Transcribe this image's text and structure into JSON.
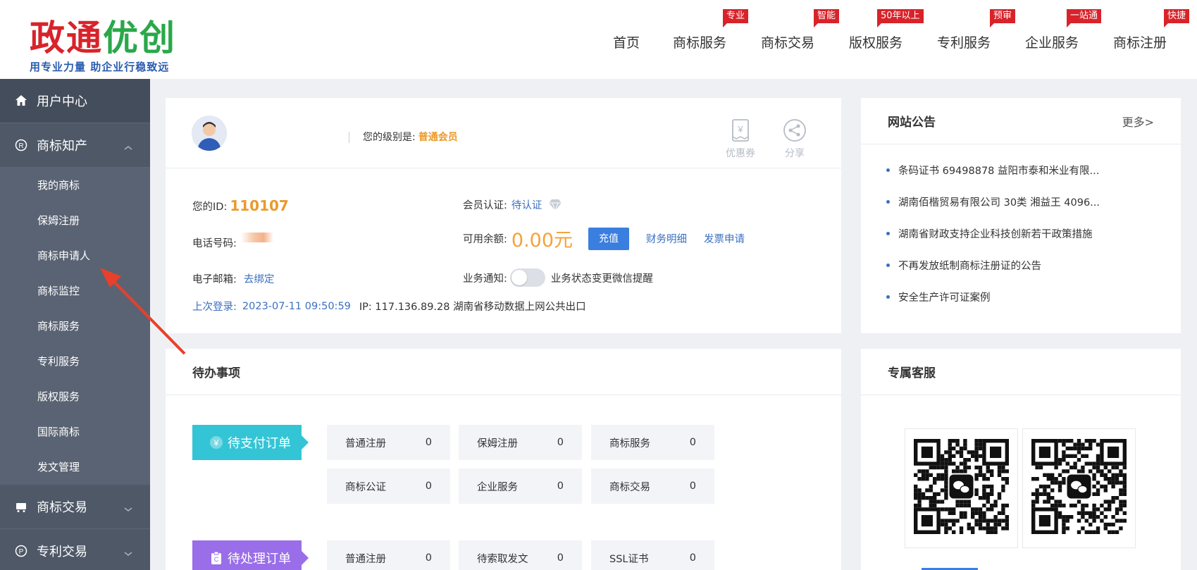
{
  "brand": {
    "name_part1": "政通",
    "name_part2": "优创",
    "slogan": "用专业力量 助企业行稳致远"
  },
  "nav": [
    {
      "label": "首页",
      "badge": ""
    },
    {
      "label": "商标服务",
      "badge": "专业"
    },
    {
      "label": "商标交易",
      "badge": "智能"
    },
    {
      "label": "版权服务",
      "badge": "50年以上"
    },
    {
      "label": "专利服务",
      "badge": "预审"
    },
    {
      "label": "企业服务",
      "badge": "一站通"
    },
    {
      "label": "商标注册",
      "badge": "快捷"
    }
  ],
  "sidebar": {
    "home": "用户中心",
    "groups": [
      {
        "label": "商标知产",
        "expanded": true,
        "icon": "registered-icon"
      },
      {
        "label": "商标交易",
        "expanded": false,
        "icon": "cart-icon"
      },
      {
        "label": "专利交易",
        "expanded": false,
        "icon": "patent-icon"
      }
    ],
    "sub_items": [
      "我的商标",
      "保姆注册",
      "商标申请人",
      "商标监控",
      "商标服务",
      "专利服务",
      "版权服务",
      "国际商标",
      "发文管理"
    ]
  },
  "profile": {
    "level_label": "您的级别是:",
    "level_value": "普通会员",
    "coupon_label": "优惠券",
    "share_label": "分享",
    "id_label": "您的ID:",
    "id_value": "110107",
    "verify_label": "会员认证:",
    "verify_value": "待认证",
    "phone_label": "电话号码:",
    "balance_label": "可用余额:",
    "balance_value": "0.00元",
    "recharge": "充值",
    "finance_detail": "财务明细",
    "invoice": "发票申请",
    "email_label": "电子邮箱:",
    "email_bind": "去绑定",
    "notify_label": "业务通知:",
    "notify_text": "业务状态变更微信提醒",
    "notify_on": false,
    "last_login_label": "上次登录:",
    "last_login_time": "2023-07-11 09:50:59",
    "ip_text": "IP: 117.136.89.28 湖南省移动数据上网公共出口"
  },
  "notice": {
    "title": "网站公告",
    "more": "更多>",
    "items": [
      "条码证书 69498878 益阳市泰和米业有限...",
      "湖南佰楷贸易有限公司 30类 湘益王 4096...",
      "湖南省财政支持企业科技创新若干政策措施",
      "不再发放纸制商标注册证的公告",
      "安全生产许可证案例"
    ]
  },
  "todo": {
    "title": "待办事项",
    "pay_tag": "待支付订单",
    "pay_items": [
      {
        "label": "普通注册",
        "count": "0"
      },
      {
        "label": "保姆注册",
        "count": "0"
      },
      {
        "label": "商标服务",
        "count": "0"
      },
      {
        "label": "商标公证",
        "count": "0"
      },
      {
        "label": "企业服务",
        "count": "0"
      },
      {
        "label": "商标交易",
        "count": "0"
      }
    ],
    "process_tag": "待处理订单",
    "process_items": [
      {
        "label": "普通注册",
        "count": "0"
      },
      {
        "label": "待索取发文",
        "count": "0"
      },
      {
        "label": "SSL证书",
        "count": "0"
      }
    ]
  },
  "service": {
    "title": "专属客服"
  },
  "colors": {
    "sidebar_bg": "#4e5867",
    "accent_blue": "#3a7fe0",
    "orange": "#f5a23a",
    "badge_red": "#d8232a",
    "tag_cyan": "#33c5d6",
    "tag_purple": "#9a6ee8"
  }
}
